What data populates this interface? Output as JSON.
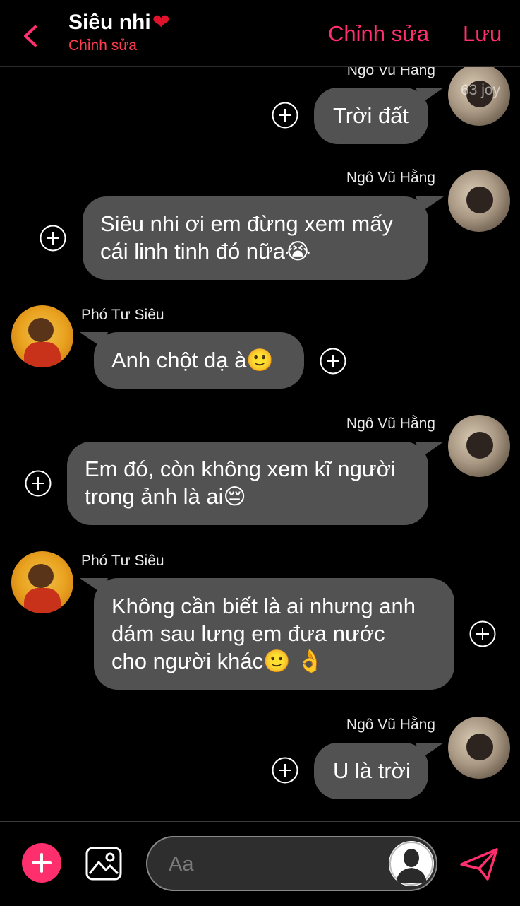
{
  "header": {
    "title": "Siêu nhi",
    "heart": "❤",
    "subtitle": "Chỉnh sửa",
    "edit_label": "Chỉnh sửa",
    "save_label": "Lưu"
  },
  "chat": {
    "watermark": "63 joy",
    "messages": [
      {
        "sender": "Ngo Vu Hang",
        "side": "right",
        "text": "Trời đất"
      },
      {
        "sender": "Ngô Vũ Hằng",
        "side": "right",
        "lines": [
          "Siêu nhi ơi em đừng xem mấy",
          "cái linh tinh đó nữa😭"
        ]
      },
      {
        "sender": "Phó Tư Siêu",
        "side": "left",
        "text": "Anh chột dạ à🙂"
      },
      {
        "sender": "Ngô Vũ Hằng",
        "side": "right",
        "lines": [
          "Em đó, còn không xem kĩ người",
          "trong ảnh là ai😔"
        ]
      },
      {
        "sender": "Phó Tư Siêu",
        "side": "left",
        "lines": [
          "Không cần biết là ai nhưng anh",
          "dám sau lưng em đưa nước",
          "cho người khác🙂 👌"
        ]
      },
      {
        "sender": "Ngô Vũ Hằng",
        "side": "right",
        "text": "U là trời"
      }
    ]
  },
  "footer": {
    "input_placeholder": "Aa"
  },
  "colors": {
    "accent": "#ff2f6d",
    "bubble": "#525252",
    "background": "#000000"
  },
  "icons": [
    "back-chevron-icon",
    "add-reaction-icon",
    "plus-icon",
    "gallery-icon",
    "user-avatar-icon",
    "send-icon"
  ]
}
